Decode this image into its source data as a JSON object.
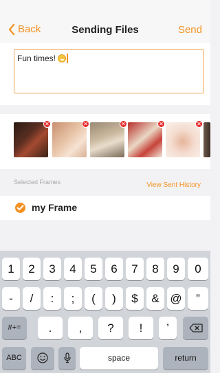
{
  "nav": {
    "back_label": "Back",
    "title": "Sending Files",
    "send_label": "Send"
  },
  "message": {
    "text": "Fun times!"
  },
  "section": {
    "selected_frames_label": "Selected Frames",
    "view_history_label": "View Sent History"
  },
  "frame": {
    "name": "my Frame"
  },
  "keyboard": {
    "row1": [
      "1",
      "2",
      "3",
      "4",
      "5",
      "6",
      "7",
      "8",
      "9",
      "0"
    ],
    "row2": [
      "-",
      "/",
      ":",
      ";",
      "(",
      ")",
      "$",
      "&",
      "@",
      "”"
    ],
    "row3_left": "#+=",
    "row3": [
      ".",
      ",",
      "?",
      "!",
      "’"
    ],
    "abc": "ABC",
    "space": "space",
    "return": "return"
  }
}
